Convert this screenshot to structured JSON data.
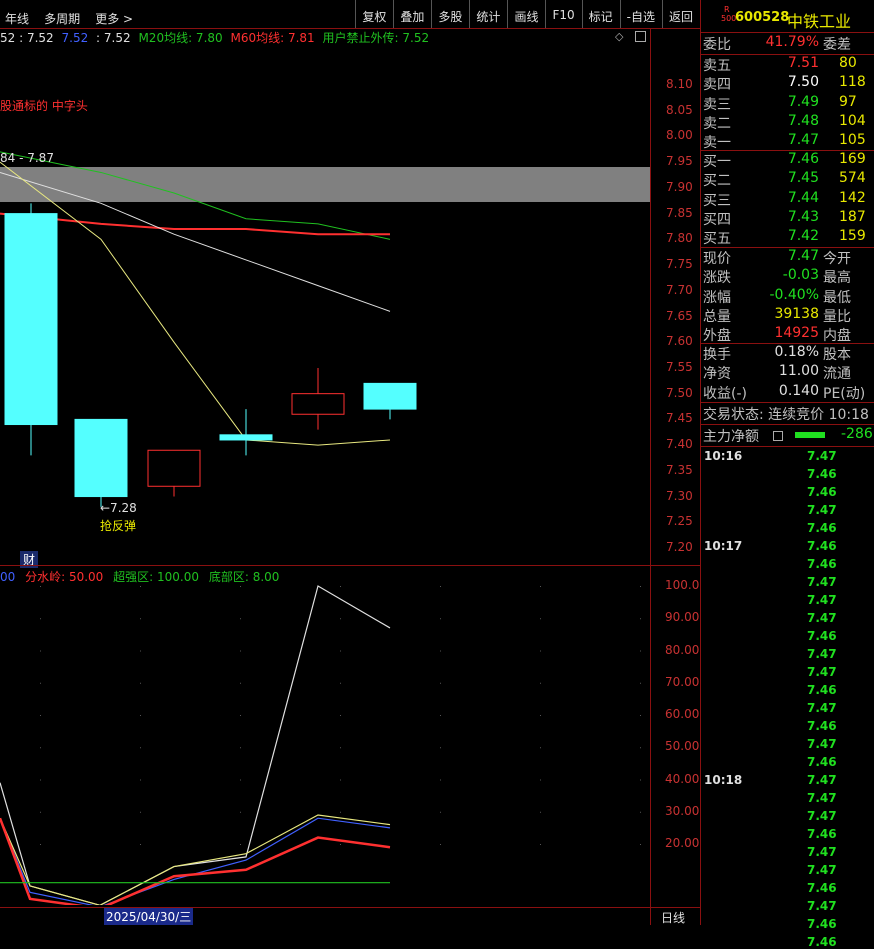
{
  "toolbar": {
    "left": [
      "年线",
      "多周期",
      "更多 >"
    ],
    "right": [
      "复权",
      "叠加",
      "多股",
      "统计",
      "画线",
      "F10",
      "标记",
      "-自选",
      "返回"
    ]
  },
  "price_legend": {
    "items": [
      {
        "text": "52 : 7.52",
        "color": "#e0e0e0"
      },
      {
        "text": "7.52",
        "color": "#4060ff"
      },
      {
        "text": ": 7.52",
        "color": "#e0e0e0"
      },
      {
        "text": "M20均线: 7.80",
        "color": "#20c020"
      },
      {
        "text": "M60均线: 7.81",
        "color": "#ff3030"
      },
      {
        "text": "用户禁止外传: 7.52",
        "color": "#20c020"
      }
    ],
    "note": "股通标的 中字头",
    "hl_label": "84 - 7.87",
    "low_label": "←7.28",
    "rebound": "抢反弹",
    "cai": "财"
  },
  "price_ticks": [
    "8.10",
    "8.05",
    "8.00",
    "7.95",
    "7.90",
    "7.85",
    "7.80",
    "7.75",
    "7.70",
    "7.65",
    "7.60",
    "7.55",
    "7.50",
    "7.45",
    "7.40",
    "7.35",
    "7.30",
    "7.25",
    "7.20"
  ],
  "osc_legend": [
    {
      "text": "00",
      "color": "#4060ff"
    },
    {
      "text": "分水岭: 50.00",
      "color": "#ff3030"
    },
    {
      "text": "超强区: 100.00",
      "color": "#20c020"
    },
    {
      "text": "底部区: 8.00",
      "color": "#20c020"
    }
  ],
  "osc_ticks": [
    "100.0",
    "90.00",
    "80.00",
    "70.00",
    "60.00",
    "50.00",
    "40.00",
    "30.00",
    "20.00"
  ],
  "date_label": "2025/04/30/三",
  "period_label": "日线",
  "stock": {
    "badge_top": "R",
    "badge_bottom": "500",
    "code": "600528",
    "name": "中铁工业"
  },
  "weibi": {
    "label": "委比",
    "value": "41.79%",
    "label2": "委差"
  },
  "asks": [
    {
      "label": "卖五",
      "price": "7.51",
      "vol": "80",
      "color": "#ff3030"
    },
    {
      "label": "卖四",
      "price": "7.50",
      "vol": "118",
      "color": "#ffffff"
    },
    {
      "label": "卖三",
      "price": "7.49",
      "vol": "97",
      "color": "#20e020"
    },
    {
      "label": "卖二",
      "price": "7.48",
      "vol": "104",
      "color": "#20e020"
    },
    {
      "label": "卖一",
      "price": "7.47",
      "vol": "105",
      "color": "#20e020"
    }
  ],
  "bids": [
    {
      "label": "买一",
      "price": "7.46",
      "vol": "169",
      "color": "#20e020"
    },
    {
      "label": "买二",
      "price": "7.45",
      "vol": "574",
      "color": "#20e020"
    },
    {
      "label": "买三",
      "price": "7.44",
      "vol": "142",
      "color": "#20e020"
    },
    {
      "label": "买四",
      "price": "7.43",
      "vol": "187",
      "color": "#20e020"
    },
    {
      "label": "买五",
      "price": "7.42",
      "vol": "159",
      "color": "#20e020"
    }
  ],
  "stats": [
    {
      "label": "现价",
      "value": "7.47",
      "color": "#20e020",
      "label2": "今开"
    },
    {
      "label": "涨跌",
      "value": "-0.03",
      "color": "#20e020",
      "label2": "最高"
    },
    {
      "label": "涨幅",
      "value": "-0.40%",
      "color": "#20e020",
      "label2": "最低"
    },
    {
      "label": "总量",
      "value": "39138",
      "color": "#e8e800",
      "label2": "量比"
    },
    {
      "label": "外盘",
      "value": "14925",
      "color": "#ff3030",
      "label2": "内盘"
    }
  ],
  "stats2": [
    {
      "label": "换手",
      "value": "0.18%",
      "color": "#e0e0e0",
      "label2": "股本"
    },
    {
      "label": "净资",
      "value": "11.00",
      "color": "#e0e0e0",
      "label2": "流通"
    },
    {
      "label": "收益(-)",
      "value": "0.140",
      "color": "#e0e0e0",
      "label2": "PE(动)"
    }
  ],
  "trade_status": "交易状态: 连续竞价 10:18",
  "main_flow": {
    "label": "主力净额",
    "value": "-286."
  },
  "ticks": [
    {
      "time": "10:16",
      "price": "7.47"
    },
    {
      "time": "",
      "price": "7.46"
    },
    {
      "time": "",
      "price": "7.46"
    },
    {
      "time": "",
      "price": "7.47"
    },
    {
      "time": "",
      "price": "7.46"
    },
    {
      "time": "10:17",
      "price": "7.46"
    },
    {
      "time": "",
      "price": "7.46"
    },
    {
      "time": "",
      "price": "7.47"
    },
    {
      "time": "",
      "price": "7.47"
    },
    {
      "time": "",
      "price": "7.47"
    },
    {
      "time": "",
      "price": "7.46"
    },
    {
      "time": "",
      "price": "7.47"
    },
    {
      "time": "",
      "price": "7.47"
    },
    {
      "time": "",
      "price": "7.46"
    },
    {
      "time": "",
      "price": "7.47"
    },
    {
      "time": "",
      "price": "7.46"
    },
    {
      "time": "",
      "price": "7.47"
    },
    {
      "time": "",
      "price": "7.46"
    },
    {
      "time": "10:18",
      "price": "7.47"
    },
    {
      "time": "",
      "price": "7.47"
    },
    {
      "time": "",
      "price": "7.47"
    },
    {
      "time": "",
      "price": "7.46"
    },
    {
      "time": "",
      "price": "7.47"
    },
    {
      "time": "",
      "price": "7.47"
    },
    {
      "time": "",
      "price": "7.46"
    },
    {
      "time": "",
      "price": "7.47"
    },
    {
      "time": "",
      "price": "7.46"
    },
    {
      "time": "",
      "price": "7.46"
    }
  ],
  "chart_data": [
    {
      "type": "candlestick",
      "ylim": [
        7.2,
        8.1
      ],
      "candles": [
        {
          "open": 7.44,
          "high": 7.87,
          "low": 7.38,
          "close": 7.85,
          "color": "cyan"
        },
        {
          "open": 7.45,
          "high": 7.45,
          "low": 7.28,
          "close": 7.3,
          "color": "cyan"
        },
        {
          "open": 7.32,
          "high": 7.39,
          "low": 7.3,
          "close": 7.39,
          "color": "red"
        },
        {
          "open": 7.42,
          "high": 7.47,
          "low": 7.38,
          "close": 7.41,
          "color": "cyan"
        },
        {
          "open": 7.46,
          "high": 7.55,
          "low": 7.43,
          "close": 7.5,
          "color": "red"
        },
        {
          "open": 7.52,
          "high": 7.52,
          "low": 7.45,
          "close": 7.47,
          "color": "cyan"
        }
      ],
      "series": [
        {
          "color": "#20c020",
          "values": [
            7.97,
            7.93,
            7.89,
            7.84,
            7.83,
            7.8
          ]
        },
        {
          "color": "#ff3030",
          "values": [
            7.85,
            7.83,
            7.82,
            7.82,
            7.81,
            7.81
          ]
        },
        {
          "color": "#e0e0e0",
          "values": [
            7.93,
            7.87,
            7.81,
            7.76,
            7.71,
            7.66
          ]
        },
        {
          "color": "#e8e880",
          "values": [
            7.95,
            7.8,
            7.6,
            7.41,
            7.4,
            7.41
          ]
        }
      ]
    },
    {
      "type": "line",
      "ylim": [
        0,
        105
      ],
      "series": [
        {
          "color": "#e0e0e0",
          "values": [
            39,
            7,
            1,
            13,
            16,
            100,
            87
          ]
        },
        {
          "color": "#4060ff",
          "values": [
            28,
            5,
            0.5,
            9,
            15,
            28,
            25
          ]
        },
        {
          "color": "#e8e880",
          "values": [
            28,
            7,
            1,
            13,
            17,
            29,
            26
          ]
        },
        {
          "color": "#ff3030",
          "values": [
            28,
            3,
            0,
            10,
            12,
            22,
            19
          ]
        },
        {
          "color": "#20c020",
          "values": [
            8,
            8,
            8,
            8,
            8,
            8,
            8
          ]
        }
      ]
    }
  ]
}
